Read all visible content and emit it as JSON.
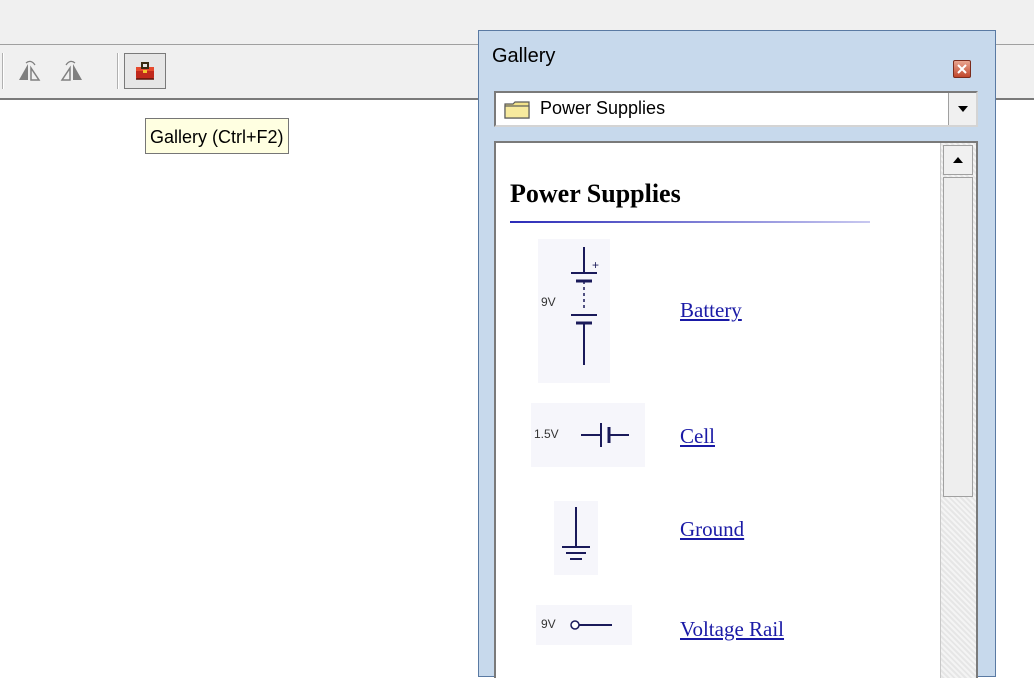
{
  "toolbar": {
    "buttons": [
      {
        "icon": "mirror-left-icon"
      },
      {
        "icon": "mirror-right-icon"
      },
      {
        "icon": "gallery-toolbox-icon"
      }
    ]
  },
  "tooltip": {
    "text": "Gallery (Ctrl+F2)"
  },
  "gallery": {
    "title": "Gallery",
    "category": "Power Supplies",
    "heading": "Power Supplies",
    "items": [
      {
        "label": "Battery",
        "thumb_label": "9V",
        "icon": "battery-symbol-icon"
      },
      {
        "label": "Cell",
        "thumb_label": "1.5V",
        "icon": "cell-symbol-icon"
      },
      {
        "label": "Ground",
        "thumb_label": "",
        "icon": "ground-symbol-icon"
      },
      {
        "label": "Voltage Rail",
        "thumb_label": "9V",
        "icon": "voltage-rail-symbol-icon"
      }
    ]
  },
  "colors": {
    "window_frame": "#c7d9ec",
    "link": "#1a1aa6",
    "tooltip_bg": "#ffffe1",
    "close_button": "#c0472d"
  }
}
